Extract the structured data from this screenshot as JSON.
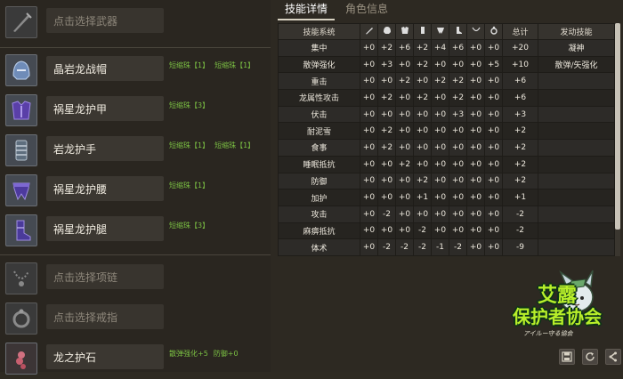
{
  "left": {
    "weapon": {
      "placeholder": "点击选择武器"
    },
    "armor": [
      {
        "name": "晶岩龙战帽",
        "icon": "helmet-icon",
        "decorations": [
          "短缩珠【1】",
          "短缩珠【1】"
        ]
      },
      {
        "name": "祸星龙护甲",
        "icon": "chest-armor-icon",
        "decorations": [
          "短缩珠【3】"
        ]
      },
      {
        "name": "岩龙护手",
        "icon": "gauntlet-icon",
        "decorations": [
          "短缩珠【1】",
          "短缩珠【1】"
        ]
      },
      {
        "name": "祸星龙护腰",
        "icon": "waist-armor-icon",
        "decorations": [
          "短缩珠【1】"
        ]
      },
      {
        "name": "祸星龙护腿",
        "icon": "leg-armor-icon",
        "decorations": [
          "短缩珠【3】"
        ]
      }
    ],
    "necklace": {
      "placeholder": "点击选择项链"
    },
    "ring": {
      "placeholder": "点击选择戒指"
    },
    "charm": {
      "name": "龙之护石",
      "skills": [
        "散弹强化+5",
        "防御+0"
      ]
    }
  },
  "tabs": [
    {
      "label": "技能详情",
      "active": true
    },
    {
      "label": "角色信息",
      "active": false
    }
  ],
  "skills_table": {
    "headers": {
      "skill_system": "技能系统",
      "slot_icons": [
        "weapon-icon",
        "helmet-icon",
        "chest-armor-icon",
        "gauntlet-icon",
        "waist-armor-icon",
        "leg-armor-icon",
        "necklace-icon",
        "ring-icon"
      ],
      "total": "总计",
      "active_skill": "发动技能"
    },
    "rows": [
      {
        "name": "集中",
        "values": [
          "+0",
          "+2",
          "+6",
          "+2",
          "+4",
          "+6",
          "+0",
          "+0"
        ],
        "total": "+20",
        "active": "凝神"
      },
      {
        "name": "散弹强化",
        "values": [
          "+0",
          "+3",
          "+0",
          "+2",
          "+0",
          "+0",
          "+0",
          "+5"
        ],
        "total": "+10",
        "active": "散弹/矢强化"
      },
      {
        "name": "重击",
        "values": [
          "+0",
          "+0",
          "+2",
          "+0",
          "+2",
          "+2",
          "+0",
          "+0"
        ],
        "total": "+6",
        "active": ""
      },
      {
        "name": "龙属性攻击",
        "values": [
          "+0",
          "+2",
          "+0",
          "+2",
          "+0",
          "+2",
          "+0",
          "+0"
        ],
        "total": "+6",
        "active": ""
      },
      {
        "name": "伏击",
        "values": [
          "+0",
          "+0",
          "+0",
          "+0",
          "+0",
          "+3",
          "+0",
          "+0"
        ],
        "total": "+3",
        "active": ""
      },
      {
        "name": "耐泥雪",
        "values": [
          "+0",
          "+2",
          "+0",
          "+0",
          "+0",
          "+0",
          "+0",
          "+0"
        ],
        "total": "+2",
        "active": ""
      },
      {
        "name": "食事",
        "values": [
          "+0",
          "+2",
          "+0",
          "+0",
          "+0",
          "+0",
          "+0",
          "+0"
        ],
        "total": "+2",
        "active": ""
      },
      {
        "name": "睡眠抵抗",
        "values": [
          "+0",
          "+0",
          "+2",
          "+0",
          "+0",
          "+0",
          "+0",
          "+0"
        ],
        "total": "+2",
        "active": ""
      },
      {
        "name": "防御",
        "values": [
          "+0",
          "+0",
          "+0",
          "+2",
          "+0",
          "+0",
          "+0",
          "+0"
        ],
        "total": "+2",
        "active": ""
      },
      {
        "name": "加护",
        "values": [
          "+0",
          "+0",
          "+0",
          "+1",
          "+0",
          "+0",
          "+0",
          "+0"
        ],
        "total": "+1",
        "active": ""
      },
      {
        "name": "攻击",
        "values": [
          "+0",
          "-2",
          "+0",
          "+0",
          "+0",
          "+0",
          "+0",
          "+0"
        ],
        "total": "-2",
        "active": ""
      },
      {
        "name": "麻痹抵抗",
        "values": [
          "+0",
          "+0",
          "+0",
          "-2",
          "+0",
          "+0",
          "+0",
          "+0"
        ],
        "total": "-2",
        "active": ""
      },
      {
        "name": "体术",
        "values": [
          "+0",
          "-2",
          "-2",
          "-2",
          "-1",
          "-2",
          "+0",
          "+0"
        ],
        "total": "-9",
        "active": ""
      }
    ]
  },
  "logo": {
    "line1": "艾露",
    "line2": "保护者协会",
    "subtitle": "アイルー守る協会"
  },
  "footer": {
    "buttons": [
      "save-icon",
      "refresh-icon",
      "share-icon"
    ]
  },
  "colors": {
    "decoration_green": "#7bc043",
    "logo_green": "#b8ef2a",
    "background": "#2e2a22"
  }
}
